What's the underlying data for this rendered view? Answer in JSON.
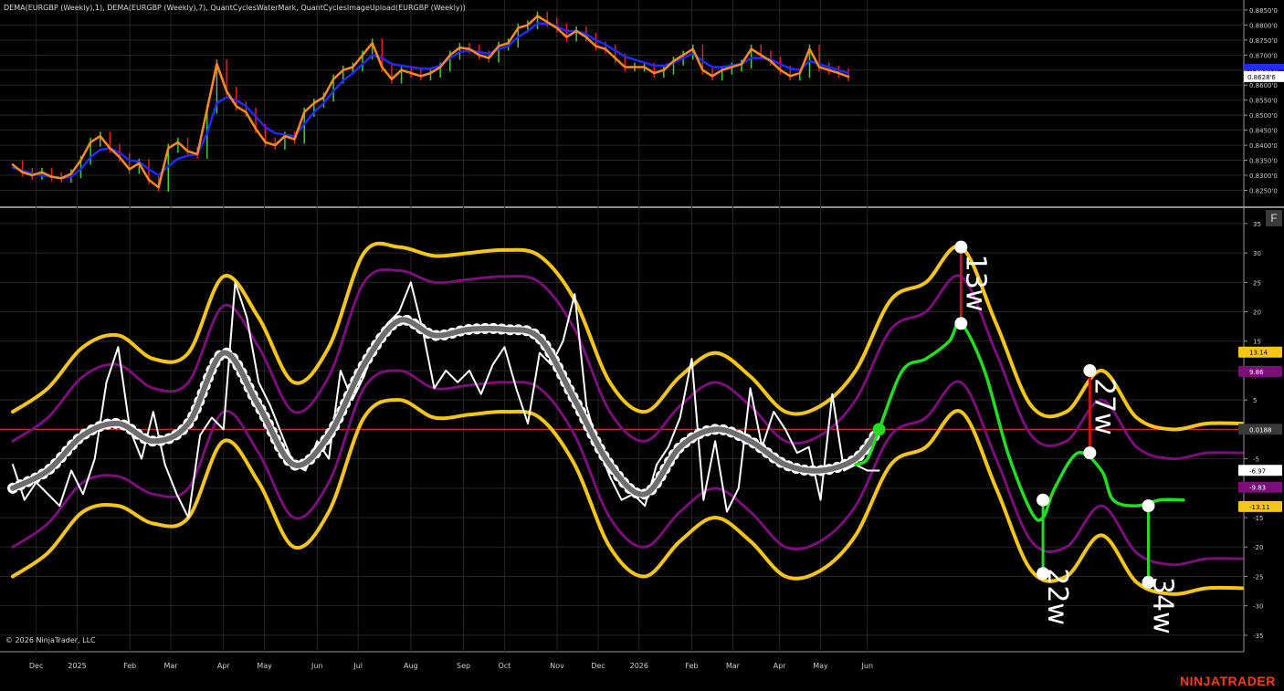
{
  "header": {
    "title": "DEMA(EURGBP (Weekly),1), DEMA(EURGBP (Weekly),7), QuantCyclesWaterMark, QuantCyclesImageUpload(EURGBP (Weekly))",
    "copyright": "© 2026 NinjaTrader, LLC",
    "brand": "NINJATRADER",
    "panel_button": "F"
  },
  "colors": {
    "background": "#000000",
    "dema1": "#ff8c1a",
    "dema7": "#1f2bff",
    "bull_bar": "#3ccf3c",
    "bear_bar": "#e02020",
    "outer_band": "#f5c518",
    "inner_band": "#7a0f7a",
    "cycle_line": "#6e6e6e",
    "projection": "#22dd22",
    "zero_line": "#cc2a2a",
    "oscillator": "#ffffff",
    "range_red": "#cc1111"
  },
  "chart_data": [
    {
      "type": "line",
      "panel": "price",
      "title": "",
      "ylim": [
        0.8215,
        0.8865
      ],
      "yticks": [
        "0.8650'0",
        "0.8600'0",
        "0.8550'0",
        "0.8500'0",
        "0.8450'0",
        "0.8400'0",
        "0.8350'0",
        "0.8300'0",
        "0.8250'0"
      ],
      "ytick_values": [
        0.865,
        0.86,
        0.855,
        0.85,
        0.845,
        0.84,
        0.835,
        0.83,
        0.825
      ],
      "extra_ticks": [
        "0.8800'0",
        "0.8750'0",
        "0.8700'0",
        "0.8850'0"
      ],
      "extra_tick_values": [
        0.88,
        0.875,
        0.87,
        0.885
      ],
      "last_price_label": "0.8628'6",
      "last_price": 0.86286,
      "x": [
        0,
        1,
        2,
        3,
        4,
        5,
        6,
        7,
        8,
        9,
        10,
        11,
        12,
        13,
        14,
        15,
        16,
        17,
        18,
        19,
        20,
        21,
        22,
        23,
        24,
        25,
        26,
        27,
        28,
        29,
        30,
        31,
        32,
        33,
        34,
        35,
        36,
        37,
        38,
        39,
        40,
        41,
        42,
        43,
        44,
        45,
        46,
        47,
        48,
        49,
        50,
        51,
        52,
        53,
        54,
        55,
        56,
        57,
        58,
        59,
        60,
        61,
        62,
        63,
        64,
        65,
        66,
        67,
        68,
        69,
        70,
        71,
        72,
        73,
        74,
        75,
        76,
        77,
        78,
        79,
        80,
        81,
        82,
        83,
        84,
        85,
        86,
        87,
        88,
        89,
        90
      ],
      "series": [
        {
          "name": "DEMA(EURGBP (Weekly),1)",
          "values": [
            0.8335,
            0.831,
            0.83,
            0.831,
            0.8295,
            0.829,
            0.8305,
            0.835,
            0.841,
            0.843,
            0.839,
            0.836,
            0.832,
            0.834,
            0.8285,
            0.826,
            0.839,
            0.841,
            0.838,
            0.837,
            0.852,
            0.867,
            0.858,
            0.853,
            0.851,
            0.8455,
            0.841,
            0.84,
            0.843,
            0.842,
            0.851,
            0.854,
            0.856,
            0.862,
            0.865,
            0.866,
            0.87,
            0.874,
            0.866,
            0.862,
            0.865,
            0.864,
            0.863,
            0.864,
            0.866,
            0.87,
            0.8725,
            0.872,
            0.87,
            0.869,
            0.873,
            0.874,
            0.879,
            0.88,
            0.883,
            0.881,
            0.879,
            0.876,
            0.878,
            0.876,
            0.873,
            0.872,
            0.869,
            0.866,
            0.866,
            0.866,
            0.864,
            0.865,
            0.868,
            0.87,
            0.872,
            0.865,
            0.863,
            0.865,
            0.866,
            0.867,
            0.872,
            0.87,
            0.868,
            0.865,
            0.863,
            0.864,
            0.872,
            0.866,
            0.865,
            0.864,
            0.8628
          ]
        },
        {
          "name": "DEMA(EURGBP (Weekly),7)",
          "values": [
            0.8325,
            0.8315,
            0.8305,
            0.83,
            0.8295,
            0.829,
            0.8295,
            0.832,
            0.836,
            0.8385,
            0.839,
            0.8375,
            0.835,
            0.8345,
            0.832,
            0.83,
            0.833,
            0.8355,
            0.8365,
            0.837,
            0.844,
            0.854,
            0.856,
            0.855,
            0.853,
            0.8495,
            0.846,
            0.844,
            0.8435,
            0.843,
            0.847,
            0.851,
            0.854,
            0.858,
            0.8615,
            0.864,
            0.867,
            0.87,
            0.869,
            0.867,
            0.8665,
            0.866,
            0.8655,
            0.8655,
            0.8665,
            0.869,
            0.871,
            0.8715,
            0.871,
            0.8705,
            0.872,
            0.873,
            0.876,
            0.878,
            0.8805,
            0.8805,
            0.8795,
            0.878,
            0.878,
            0.877,
            0.875,
            0.8735,
            0.8715,
            0.8695,
            0.8685,
            0.8675,
            0.8665,
            0.8665,
            0.8675,
            0.869,
            0.8705,
            0.868,
            0.866,
            0.866,
            0.8665,
            0.867,
            0.869,
            0.869,
            0.8685,
            0.867,
            0.8655,
            0.865,
            0.868,
            0.867,
            0.866,
            0.865,
            0.864
          ]
        }
      ]
    },
    {
      "type": "line",
      "panel": "cycles",
      "title": "",
      "ylim": [
        -37.5,
        37
      ],
      "yticks": [
        "35",
        "30",
        "25",
        "20",
        "15",
        "10",
        "5",
        "0",
        "-5",
        "-10",
        "-15",
        "-20",
        "-25",
        "-30",
        "-35"
      ],
      "ytick_values": [
        35,
        30,
        25,
        20,
        15,
        10,
        5,
        0,
        -5,
        -10,
        -15,
        -20,
        -25,
        -30,
        -35
      ],
      "xticks": [
        "Dec",
        "2025",
        "Feb",
        "Mar",
        "Apr",
        "May",
        "Jun",
        "Jul",
        "Aug",
        "Sep",
        "Oct",
        "Nov",
        "Dec",
        "2026",
        "Feb",
        "Mar",
        "Apr",
        "May",
        "Jun"
      ],
      "xtick_positions": [
        2,
        5.5,
        10,
        13.5,
        18,
        21.5,
        26,
        29.5,
        34,
        38.5,
        42,
        46.5,
        50,
        53.5,
        58,
        61.5,
        65.5,
        69,
        73
      ],
      "value_labels": [
        {
          "text": "13.14",
          "value": 13.14,
          "color": "#f5c518"
        },
        {
          "text": "9.86",
          "value": 9.86,
          "color": "#7a0f7a"
        },
        {
          "text": "0.0188",
          "value": 0.0188,
          "color": "#3a3a3a"
        },
        {
          "text": "-6.97",
          "value": -6.97,
          "color": "#ffffff"
        },
        {
          "text": "-9.83",
          "value": -9.83,
          "color": "#7a0f7a"
        },
        {
          "text": "-13.11",
          "value": -13.11,
          "color": "#f5c518"
        }
      ],
      "cycle_x": [
        0,
        3,
        6,
        9,
        12,
        15,
        18,
        21,
        24,
        27,
        30,
        33,
        36,
        39,
        42,
        45,
        48,
        51,
        54,
        57,
        60,
        63,
        66,
        69,
        72,
        74
      ],
      "cycle_values": [
        -10,
        -7,
        -1,
        1,
        -2,
        1,
        13,
        4,
        -6,
        -1,
        11,
        18.5,
        16,
        17,
        17,
        15.5,
        5,
        -6,
        -11,
        -3,
        0,
        -2,
        -6,
        -7,
        -5,
        0
      ],
      "oscillator_x": [
        0,
        1,
        2,
        3,
        4,
        5,
        6,
        7,
        8,
        9,
        10,
        11,
        12,
        13,
        14,
        15,
        16,
        17,
        18,
        19,
        20,
        21,
        22,
        23,
        24,
        25,
        26,
        27,
        28,
        29,
        30,
        31,
        32,
        33,
        34,
        35,
        36,
        37,
        38,
        39,
        40,
        41,
        42,
        43,
        44,
        45,
        46,
        47,
        48,
        49,
        50,
        51,
        52,
        53,
        54,
        55,
        56,
        57,
        58,
        59,
        60,
        61,
        62,
        63,
        64,
        65,
        66,
        67,
        68,
        69,
        70,
        71,
        72,
        73,
        74
      ],
      "oscillator_values": [
        -6,
        -12,
        -9,
        -11,
        -13,
        -7,
        -11,
        -5,
        8,
        14,
        0,
        -5,
        3,
        -6,
        -11,
        -15,
        -1,
        2,
        0,
        25,
        19,
        8,
        4,
        -1,
        -6,
        -7,
        -2,
        -5,
        10,
        5,
        9,
        15,
        18,
        20,
        25,
        17,
        7,
        10,
        8,
        10,
        6,
        11,
        14,
        7,
        1,
        13,
        11,
        15,
        23,
        4,
        -3,
        -8,
        -12,
        -11,
        -13,
        -6,
        -3,
        2,
        12,
        -12,
        -2,
        -14,
        -10,
        7,
        -3,
        3,
        0,
        -4,
        -3,
        -12,
        6,
        -7,
        -6,
        -7,
        -7
      ],
      "outer_upper_x": [
        0,
        3,
        6,
        9,
        12,
        15,
        18,
        21,
        24,
        27,
        30,
        33,
        36,
        39,
        42,
        45,
        48,
        51,
        54,
        57,
        60,
        63,
        66,
        69,
        72,
        75,
        78,
        81,
        84,
        87,
        90,
        93,
        96,
        99,
        102,
        105
      ],
      "outer_upper": [
        3,
        7,
        14,
        16,
        12,
        13,
        26,
        19,
        8,
        14,
        30,
        31,
        29.5,
        30,
        30.5,
        29.5,
        22,
        8,
        3,
        9,
        13,
        9,
        3,
        4,
        10,
        22,
        25,
        31,
        18,
        4,
        3,
        10,
        2,
        0,
        1,
        1
      ],
      "inner_upper": [
        -2,
        2,
        9,
        11,
        7,
        8,
        21,
        14,
        3,
        9,
        25,
        27,
        25,
        25.5,
        26,
        25,
        17,
        3,
        -2,
        4,
        8,
        4,
        -2,
        -1,
        5,
        17,
        20,
        26,
        13,
        -1,
        -2,
        5,
        -3,
        -5,
        -4,
        -4
      ],
      "inner_lower": [
        -20,
        -16,
        -9,
        -8,
        -11,
        -10,
        3,
        -4,
        -15,
        -9,
        7,
        10,
        7,
        7.5,
        8,
        7,
        -1,
        -15,
        -20,
        -14,
        -10,
        -14,
        -20,
        -19,
        -13,
        -1,
        2,
        8,
        -5,
        -19,
        -20,
        -13,
        -21,
        -23,
        -22,
        -22
      ],
      "outer_lower": [
        -25,
        -21,
        -14,
        -13,
        -16,
        -15,
        -2,
        -9,
        -20,
        -14,
        2,
        5,
        2,
        2.5,
        3,
        2,
        -6,
        -20,
        -25,
        -19,
        -15,
        -19,
        -25,
        -24,
        -18,
        -6,
        -3,
        3,
        -10,
        -24,
        -25,
        -18,
        -26,
        -28,
        -27,
        -27
      ],
      "projection_x": [
        72,
        73,
        74,
        76,
        78,
        80,
        81,
        83,
        85,
        87,
        88,
        89,
        91,
        93,
        94,
        96,
        98,
        100
      ],
      "projection_values": [
        -6,
        -5,
        0,
        10,
        12,
        15,
        18,
        10,
        -4,
        -14,
        -15,
        -10,
        -4,
        -7,
        -12,
        -13,
        -12,
        -12
      ],
      "cycle_markers": [
        {
          "label": "13w",
          "x": 81,
          "top": 31,
          "bottom": 18,
          "color": "#cc1111"
        },
        {
          "label": "22w",
          "x": 88,
          "top": -12,
          "bottom": -24.5,
          "color": "#22dd22"
        },
        {
          "label": "27w",
          "x": 92,
          "top": 10,
          "bottom": -4,
          "color": "#cc1111"
        },
        {
          "label": "34w",
          "x": 97,
          "top": -13,
          "bottom": -26,
          "color": "#22dd22"
        }
      ]
    }
  ]
}
